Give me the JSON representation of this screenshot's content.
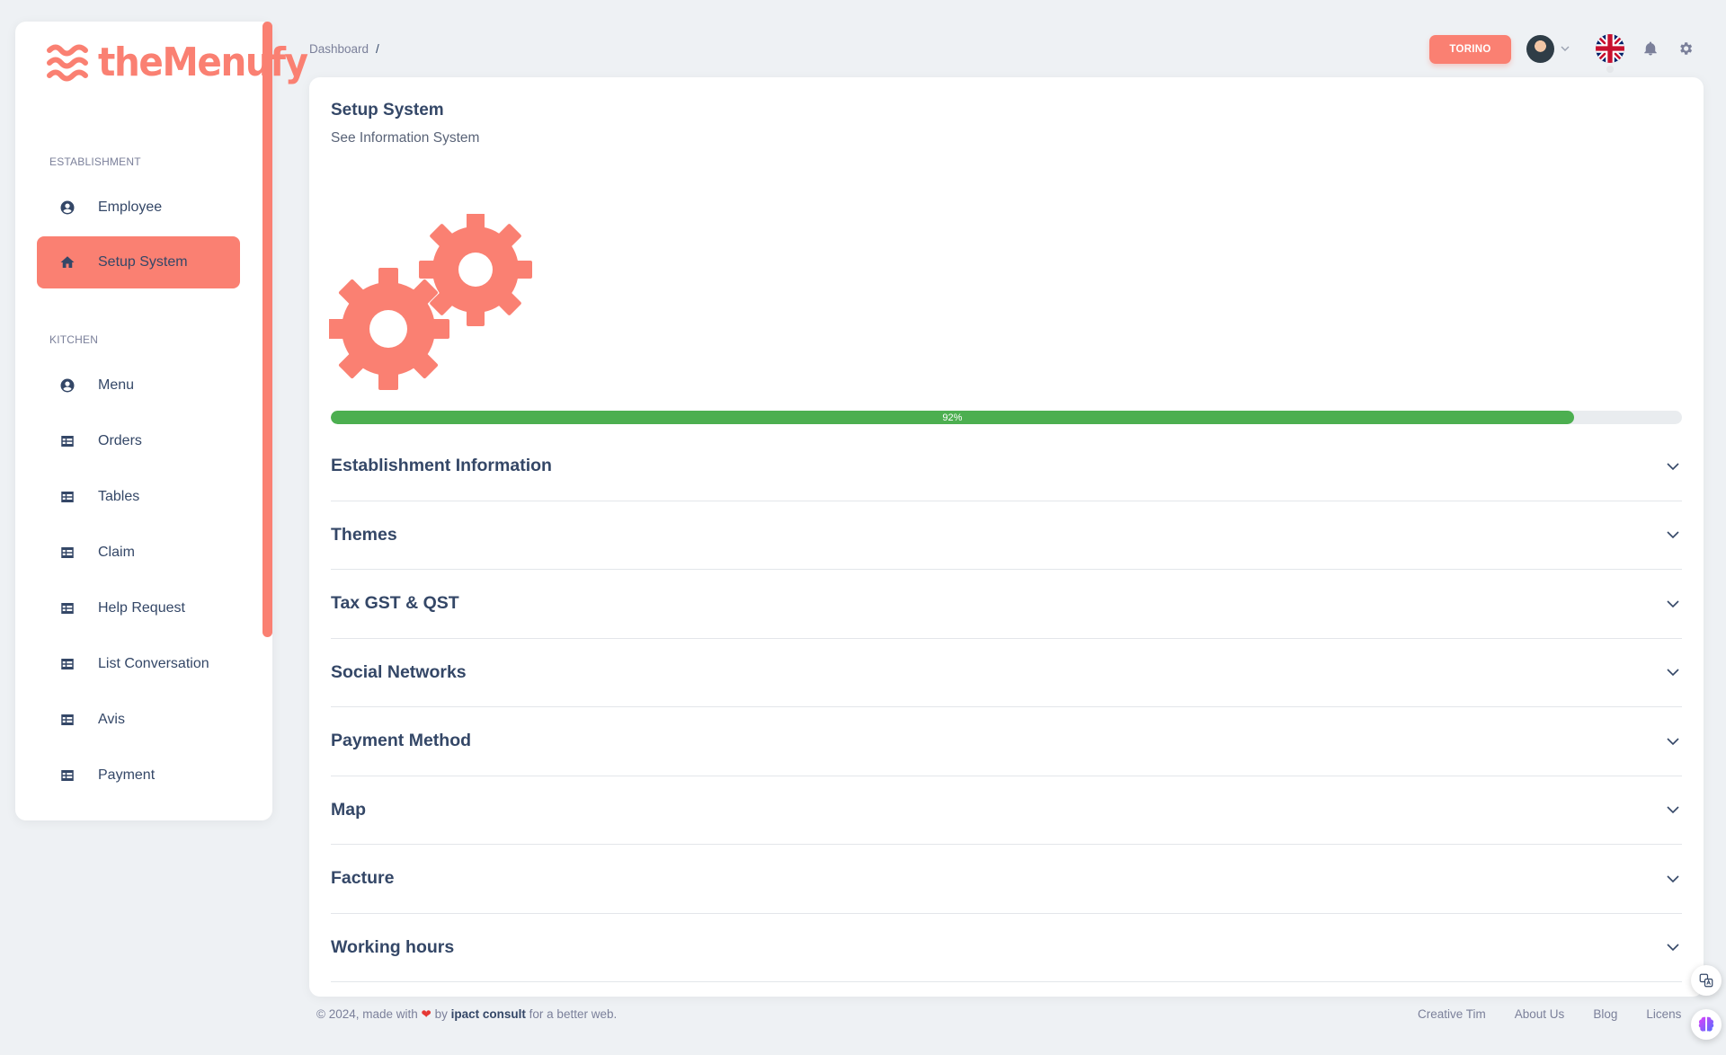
{
  "app": {
    "logo_text": "theMenufy",
    "brand_color": "#fa8072"
  },
  "sidebar": {
    "sections": [
      {
        "label": "ESTABLISHMENT",
        "items": [
          {
            "label": "Employee",
            "icon": "user-circle-icon",
            "active": false
          },
          {
            "label": "Setup System",
            "icon": "home-icon",
            "active": true
          }
        ]
      },
      {
        "label": "KITCHEN",
        "items": [
          {
            "label": "Menu",
            "icon": "user-circle-icon",
            "active": false
          },
          {
            "label": "Orders",
            "icon": "table-icon",
            "active": false
          },
          {
            "label": "Tables",
            "icon": "table-icon",
            "active": false
          },
          {
            "label": "Claim",
            "icon": "table-icon",
            "active": false
          },
          {
            "label": "Help Request",
            "icon": "table-icon",
            "active": false
          },
          {
            "label": "List Conversation",
            "icon": "table-icon",
            "active": false
          },
          {
            "label": "Avis",
            "icon": "table-icon",
            "active": false
          },
          {
            "label": "Payment",
            "icon": "table-icon",
            "active": false
          }
        ]
      }
    ]
  },
  "header": {
    "breadcrumb": [
      "Dashboard"
    ],
    "breadcrumb_separator": "/",
    "location_button": "TORINO",
    "language": "English (UK flag)"
  },
  "main": {
    "title": "Setup System",
    "subtitle": "See Information System",
    "progress": {
      "value": 92,
      "label": "92%",
      "color": "#4caf50"
    },
    "sections": [
      "Establishment Information",
      "Themes",
      "Tax GST & QST",
      "Social Networks",
      "Payment Method",
      "Map",
      "Facture",
      "Working hours"
    ]
  },
  "footer": {
    "copyright_prefix": "© 2024, made with",
    "heart": "❤",
    "by": "by",
    "company": "ipact consult",
    "suffix": "for a better web.",
    "links": [
      "Creative Tim",
      "About Us",
      "Blog",
      "Licens"
    ]
  }
}
